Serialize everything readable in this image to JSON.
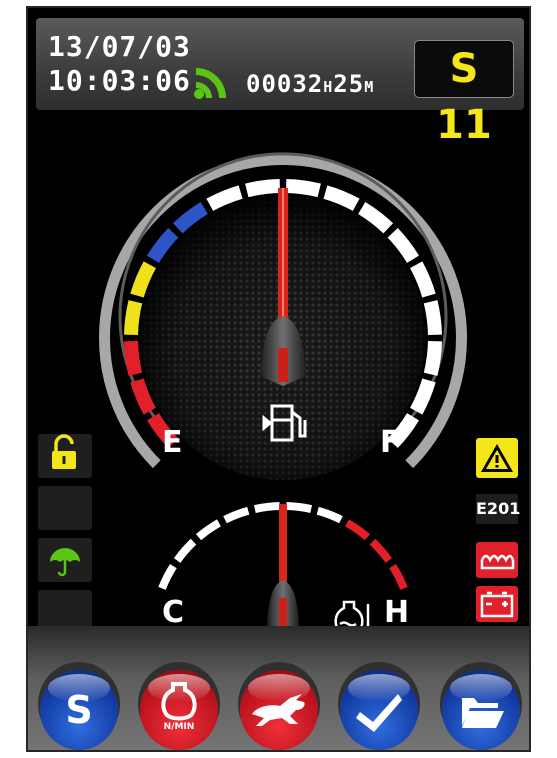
{
  "status": {
    "date": "13/07/03",
    "time": "10:03:06",
    "hour_meter": "00032",
    "hour_unit": "H",
    "minute_meter": "25",
    "minute_unit": "M",
    "speed_mode": "S 11",
    "signal_icon": "wifi-signal-icon",
    "signal_color": "#5bc414"
  },
  "fuel_gauge": {
    "empty_label": "E",
    "full_label": "F",
    "icon": "fuel-pump-icon",
    "level_fraction": 0.5,
    "needle_color": "#d7261d"
  },
  "temp_gauge": {
    "cold_label": "C",
    "hot_label": "H",
    "icon": "coolant-temperature-icon",
    "level_fraction": 0.5
  },
  "left_indicators": [
    {
      "icon": "padlock-open-icon",
      "color": "#f5e61a"
    },
    {
      "icon": "",
      "color": ""
    },
    {
      "icon": "umbrella-icon",
      "color": "#5bc414"
    },
    {
      "icon": "",
      "color": ""
    }
  ],
  "right_indicators": {
    "warning_icon": "warning-triangle-icon",
    "error_code": "E201",
    "glow_plug_icon": "glow-plug-icon",
    "battery_icon": "battery-icon",
    "alert_color": "#e0202b",
    "warning_color": "#f5e61a"
  },
  "buttons": [
    {
      "label": "S",
      "icon": "speed-mode-icon",
      "color": "blue"
    },
    {
      "label": "N/MIN",
      "icon": "engine-rpm-icon",
      "color": "red"
    },
    {
      "label": "",
      "icon": "rabbit-fast-icon",
      "color": "red"
    },
    {
      "label": "",
      "icon": "checkmark-icon",
      "color": "blue"
    },
    {
      "label": "",
      "icon": "folder-icon",
      "color": "blue"
    }
  ]
}
